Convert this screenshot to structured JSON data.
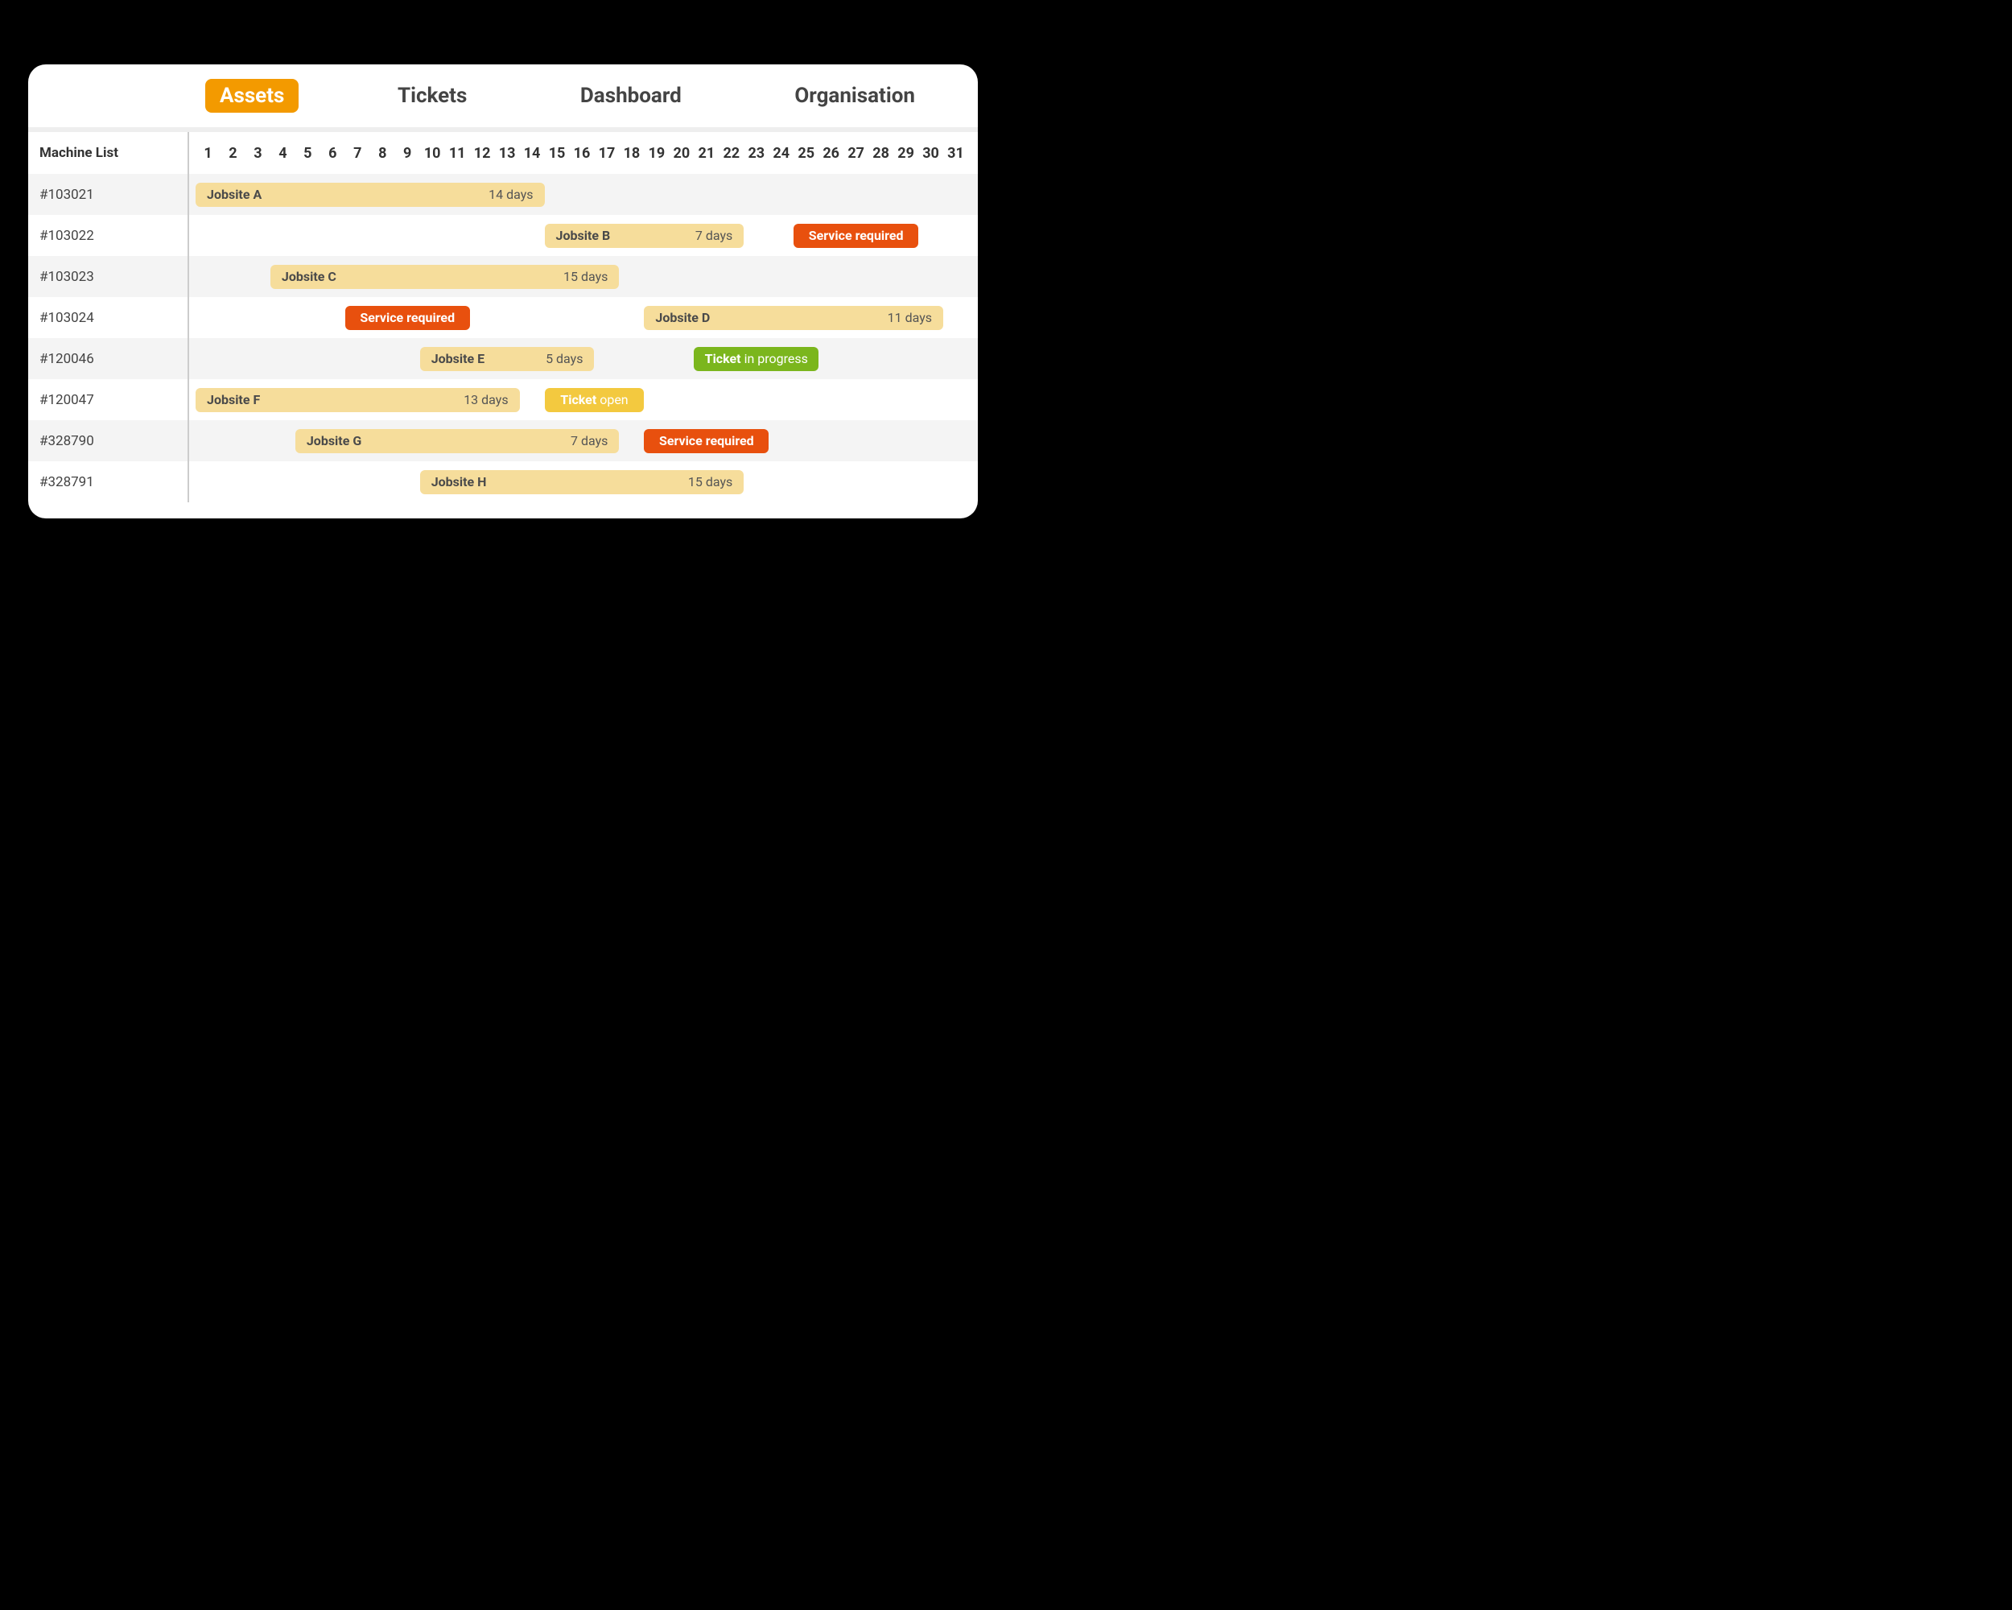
{
  "tabs": [
    {
      "label": "Assets",
      "active": true
    },
    {
      "label": "Tickets",
      "active": false
    },
    {
      "label": "Dashboard",
      "active": false
    },
    {
      "label": "Organisation",
      "active": false
    }
  ],
  "sidebar_header": "Machine List",
  "days": [
    "1",
    "2",
    "3",
    "4",
    "5",
    "6",
    "7",
    "8",
    "9",
    "10",
    "11",
    "12",
    "13",
    "14",
    "15",
    "16",
    "17",
    "18",
    "19",
    "20",
    "21",
    "22",
    "23",
    "24",
    "25",
    "26",
    "27",
    "28",
    "29",
    "30",
    "31"
  ],
  "rows": [
    {
      "id": "#103021",
      "bars": [
        {
          "type": "jobsite",
          "label": "Jobsite A",
          "duration": "14 days",
          "start": 1,
          "span": 14
        }
      ]
    },
    {
      "id": "#103022",
      "bars": [
        {
          "type": "jobsite",
          "label": "Jobsite B",
          "duration": "7 days",
          "start": 15,
          "span": 8
        },
        {
          "type": "service",
          "label": "Service required",
          "start": 25,
          "span": 5
        }
      ]
    },
    {
      "id": "#103023",
      "bars": [
        {
          "type": "jobsite",
          "label": "Jobsite C",
          "duration": "15 days",
          "start": 4,
          "span": 14
        }
      ]
    },
    {
      "id": "#103024",
      "bars": [
        {
          "type": "service",
          "label": "Service required",
          "start": 7,
          "span": 5
        },
        {
          "type": "jobsite",
          "label": "Jobsite D",
          "duration": "11 days",
          "start": 19,
          "span": 12
        }
      ]
    },
    {
      "id": "#120046",
      "bars": [
        {
          "type": "jobsite",
          "label": "Jobsite E",
          "duration": "5 days",
          "start": 10,
          "span": 7
        },
        {
          "type": "ticket-progress",
          "label_bold": "Ticket",
          "label_rest": " in progress",
          "start": 21,
          "span": 5
        }
      ]
    },
    {
      "id": "#120047",
      "bars": [
        {
          "type": "jobsite",
          "label": "Jobsite F",
          "duration": "13 days",
          "start": 1,
          "span": 13
        },
        {
          "type": "ticket-open",
          "label_bold": "Ticket",
          "label_rest": " open",
          "start": 15,
          "span": 4
        }
      ]
    },
    {
      "id": "#328790",
      "bars": [
        {
          "type": "jobsite",
          "label": "Jobsite G",
          "duration": "7 days",
          "start": 5,
          "span": 13
        },
        {
          "type": "service",
          "label": "Service required",
          "start": 19,
          "span": 5
        }
      ]
    },
    {
      "id": "#328791",
      "bars": [
        {
          "type": "jobsite",
          "label": "Jobsite H",
          "duration": "15 days",
          "start": 10,
          "span": 13
        }
      ]
    }
  ],
  "colors": {
    "accent": "#f39a00",
    "jobsite": "#f6dd9b",
    "service": "#e8500e",
    "ticket_progress": "#7bb61d",
    "ticket_open": "#f3c93f"
  }
}
